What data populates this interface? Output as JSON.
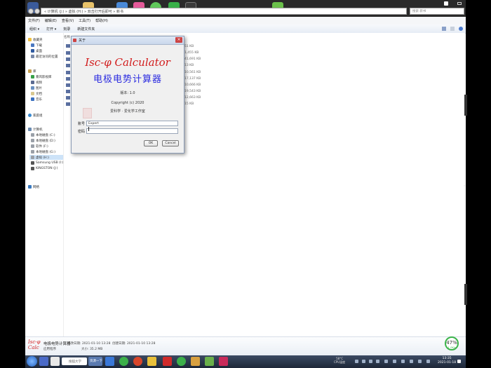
{
  "address_bar": {
    "path": "« 计算机 (J:) » 虚拟 (H:) » 双击打开后即可 » 新书"
  },
  "search": {
    "placeholder": "搜索 新书"
  },
  "overlay": {
    "letter": "J"
  },
  "menubar": [
    "文件(F)",
    "编辑(E)",
    "查看(V)",
    "工具(T)",
    "帮助(H)"
  ],
  "toolbar": {
    "organize": "组织 ▾",
    "open": "打开 ▾",
    "burn": "刻录",
    "new_folder": "新建文件夹"
  },
  "file_list": {
    "column_header": "名称",
    "sizes": [
      "51 KB",
      "1,455 KB",
      "41,691 KB",
      "13 KB",
      "10,561 KB",
      "17,137 KB",
      "10,666 KB",
      "19,543 KB",
      "12,663 KB",
      "15 KB"
    ]
  },
  "sidebar": {
    "favorites": {
      "title": "收藏夹",
      "items": [
        "下载",
        "桌面",
        "最近访问的位置"
      ]
    },
    "libraries": {
      "title": "库",
      "items": [
        "暴风影视库",
        "视频",
        "图片",
        "文档",
        "音乐"
      ]
    },
    "homegroup": "家庭组",
    "computer": {
      "title": "计算机",
      "items": [
        "本地磁盘 (C:)",
        "本地磁盘 (D:)",
        "软件 (F:)",
        "本地磁盘 (G:)",
        "虚拟 (H:)",
        "Samsung USB (I:)",
        "KINGSTON (J:)"
      ]
    },
    "network": "网络"
  },
  "dialog": {
    "title": "关于",
    "app_name_en": "Isc-φ Calculator",
    "app_name_cn": "电极电势计算器",
    "version": "版本: 1.0",
    "copyright": "Copyright (c) 2020",
    "org": "爱科学 · 爱化学工作室",
    "account_label": "账号",
    "account_value": "Expert",
    "password_label": "密码",
    "password_value": "",
    "ok_label": "OK",
    "cancel_label": "Cancel"
  },
  "details": {
    "logo_line1": "Isc-φ",
    "logo_line2": "Calc",
    "name": "电极电势计算器",
    "type": "应用程序",
    "modified": "修改日期: 2021-01-10 13:28",
    "created": "创建日期: 2021-01-10 13:28",
    "size": "大小: 35.2 MB"
  },
  "badge": {
    "percent": "47%",
    "speed": "↑ 0K/s"
  },
  "taskbar": {
    "search_text": "搜狐大学",
    "active_label": "资源一下",
    "cpu_line1": "58°C",
    "cpu_line2": "CPU温度",
    "clock_time": "13:35",
    "clock_date": "2021-01-18"
  }
}
